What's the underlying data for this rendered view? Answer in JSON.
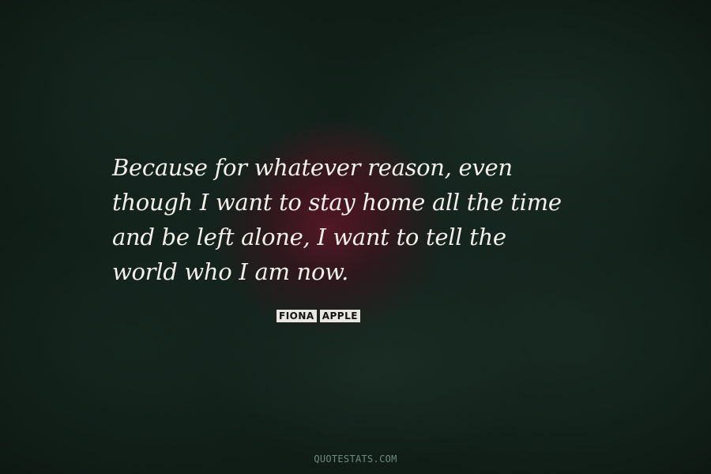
{
  "quote": {
    "lines": [
      "Because for whatever reason, even",
      "though I want to stay home all the time",
      "and be left alone, I want to tell the",
      "world who I am now."
    ]
  },
  "author": {
    "first": "FIONA",
    "last": "APPLE"
  },
  "watermark": "QUOTESTATS.COM",
  "colors": {
    "quote_text": "#f2f0ec",
    "author_label_bg": "#e8e6e2",
    "background": "#122019",
    "rose": "#781830"
  }
}
